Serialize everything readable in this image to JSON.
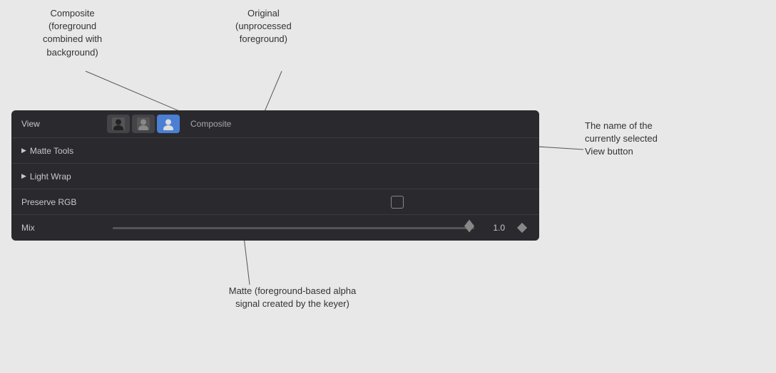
{
  "annotations": {
    "composite_title": "Composite",
    "composite_desc_line1": "(foreground",
    "composite_desc_line2": "combined with",
    "composite_desc_line3": "background)",
    "original_title": "Original",
    "original_desc_line1": "(unprocessed",
    "original_desc_line2": "foreground)",
    "name_label_line1": "The name of the",
    "name_label_line2": "currently selected",
    "name_label_line3": "View button",
    "matte_line1": "Matte (foreground-based alpha",
    "matte_line2": "signal created by the keyer)"
  },
  "panel": {
    "view_label": "View",
    "composite_text": "Composite",
    "matte_tools_label": "Matte Tools",
    "light_wrap_label": "Light Wrap",
    "preserve_rgb_label": "Preserve RGB",
    "mix_label": "Mix",
    "mix_value": "1.0"
  },
  "icons": {
    "person_dark": "person-dark",
    "person_medium": "person-medium",
    "person_blue": "person-blue"
  }
}
